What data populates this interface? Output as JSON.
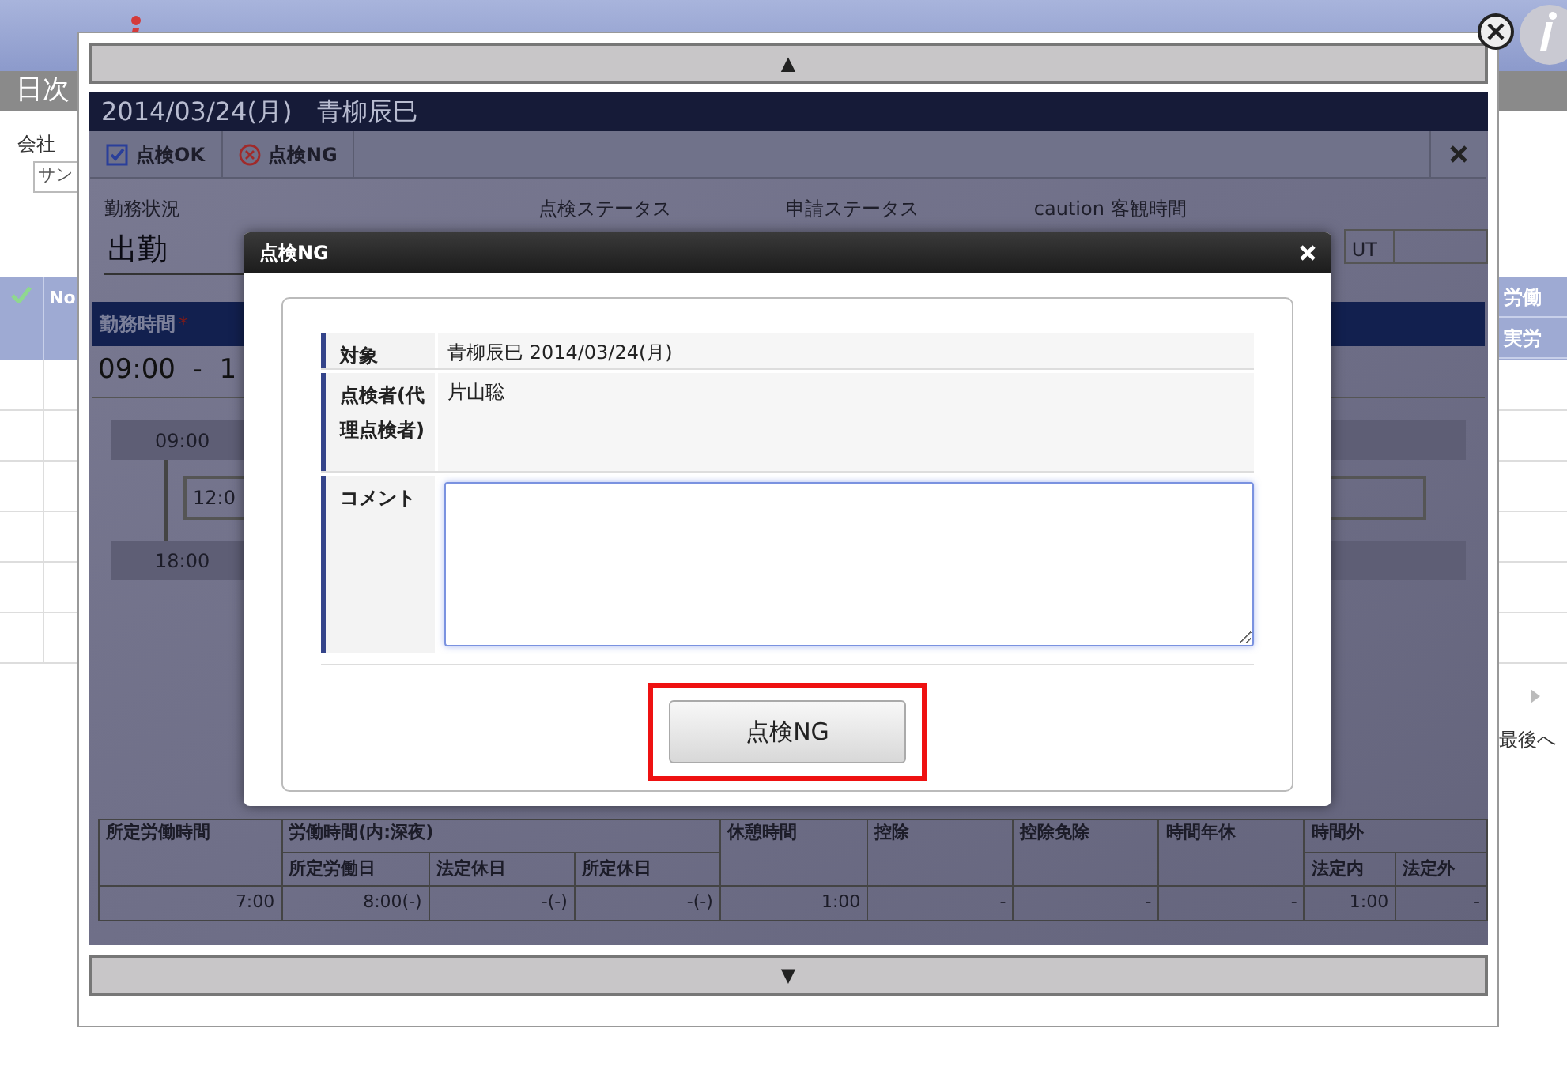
{
  "background_page": {
    "page_title": "日次",
    "company_label": "会社",
    "company_select": "サン",
    "table_columns": [
      "No"
    ],
    "right_columns": [
      "労働",
      "実労"
    ],
    "pager_last": "最後へ"
  },
  "frame": {
    "scroll_up": "▲",
    "scroll_down": "▼"
  },
  "record": {
    "title": "2014/03/24(月)　青柳辰巳",
    "toolbar": [
      {
        "label": "点検OK",
        "kind": "ok"
      },
      {
        "label": "点検NG",
        "kind": "ng"
      }
    ],
    "fields": [
      {
        "label": "勤務状況",
        "value": "出勤"
      },
      {
        "label": "点検ステータス"
      },
      {
        "label": "申請ステータス"
      },
      {
        "label": "caution 客観時間"
      }
    ],
    "partial_value": "UT",
    "work_time": {
      "label": "勤務時間",
      "required_mark": "*",
      "range": "09:00  -  1",
      "timeline": [
        "09:00",
        "12:0",
        "18:00"
      ]
    },
    "summary": {
      "columns": [
        {
          "label": "所定労働時間"
        },
        {
          "label": "労働時間(内:深夜)",
          "children": [
            "所定労働日",
            "法定休日",
            "所定休日"
          ]
        },
        {
          "label": "休憩時間"
        },
        {
          "label": "控除"
        },
        {
          "label": "控除免除"
        },
        {
          "label": "時間年休"
        },
        {
          "label": "時間外",
          "children": [
            "法定内",
            "法定外"
          ]
        }
      ],
      "values": [
        "7:00",
        "8:00(-)",
        "-(-)",
        "-(-)",
        "1:00",
        "-",
        "-",
        "-",
        "1:00",
        "-"
      ]
    }
  },
  "dialog": {
    "title": "点検NG",
    "rows": [
      {
        "label": "対象",
        "kind": "text",
        "value": "青柳辰巳 2014/03/24(月)"
      },
      {
        "label": "点検者(代理点検者)",
        "kind": "text",
        "value": "片山聡"
      },
      {
        "label": "コメント",
        "kind": "textarea"
      }
    ],
    "submit": {
      "label": "点検NG",
      "highlighted": true
    }
  }
}
